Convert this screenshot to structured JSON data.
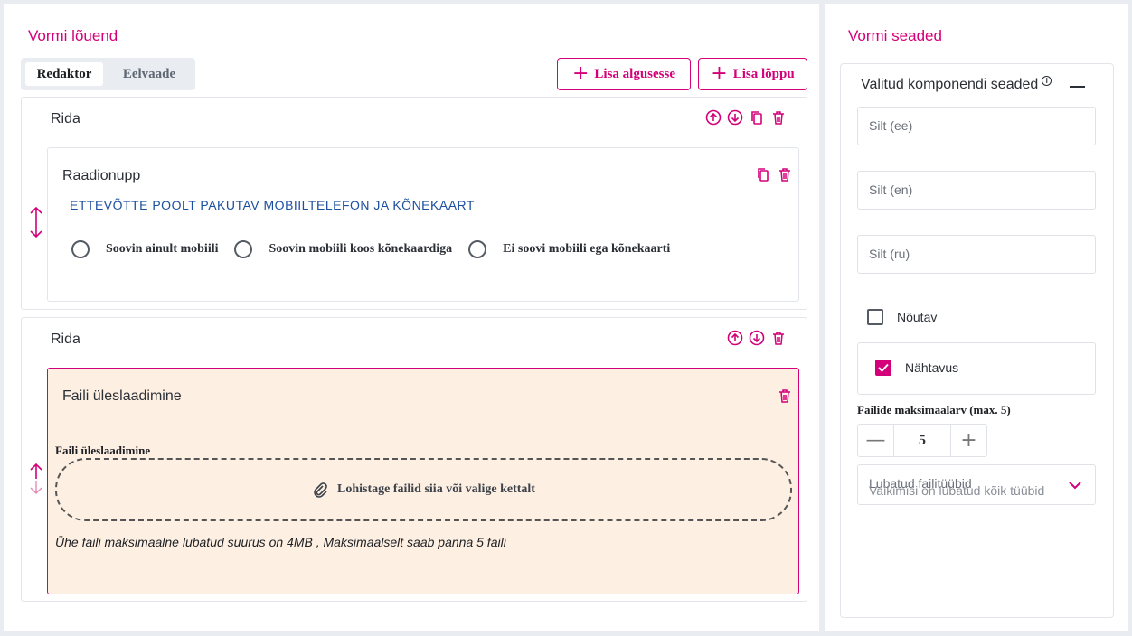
{
  "canvas": {
    "title": "Vormi lõuend",
    "tabs": [
      {
        "label": "Redaktor",
        "active": true
      },
      {
        "label": "Eelvaade",
        "active": false
      }
    ],
    "buttons": {
      "add_start": "Lisa algusesse",
      "add_end": "Lisa lõppu"
    },
    "rows": [
      {
        "title": "Rida",
        "component": {
          "title": "Raadionupp",
          "question": "ETTEVÕTTE POOLT PAKUTAV MOBIILTELEFON JA KÕNEKAART",
          "options": [
            "Soovin ainult mobiili",
            "Soovin mobiili koos kõnekaardiga",
            "Ei soovi mobiili ega kõnekaarti"
          ]
        }
      },
      {
        "title": "Rida",
        "component": {
          "title": "Faili üleslaadimine",
          "field_label": "Faili üleslaadimine",
          "dropzone_text": "Lohistage failid siia või valige kettalt",
          "note": "Ühe faili maksimaalne lubatud suurus on 4MB , Maksimaalselt saab panna 5 faili"
        }
      }
    ]
  },
  "settings": {
    "title": "Vormi seaded",
    "section_title": "Valitud komponendi seaded",
    "inputs": [
      {
        "placeholder": "Silt (ee)"
      },
      {
        "placeholder": "Silt (en)"
      },
      {
        "placeholder": "Silt (ru)"
      }
    ],
    "required": {
      "label": "Nõutav",
      "checked": false
    },
    "visibility": {
      "label": "Nähtavus",
      "checked": true
    },
    "max_files": {
      "label": "Failide maksimaalarv (max. 5)",
      "value": "5"
    },
    "file_types": {
      "label": "Lubatud failitüübid",
      "placeholder": "Vaikimisi on lubatud kõik tüübid"
    }
  },
  "colors": {
    "accent": "#d4007a",
    "question": "#1c4fa0",
    "active_bg": "#fdf0e3"
  }
}
